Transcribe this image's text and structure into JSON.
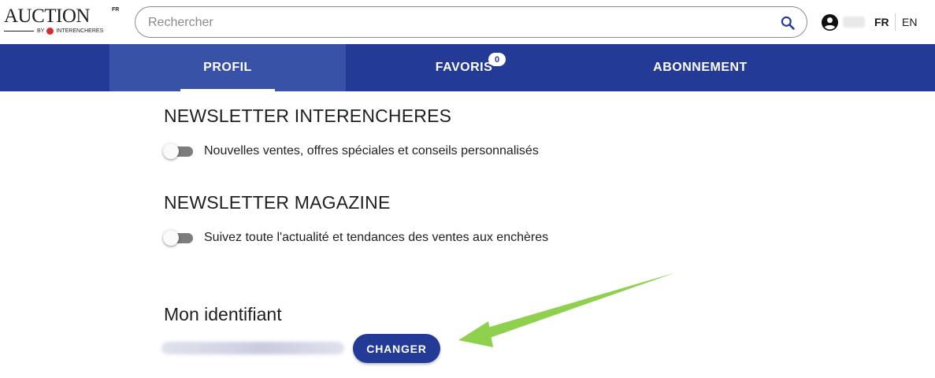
{
  "header": {
    "logo": {
      "main": "AUCTION",
      "superscript": "FR",
      "by": "BY",
      "brand": "INTERENCHERES"
    },
    "search": {
      "placeholder": "Rechercher",
      "value": "",
      "icon": "search-icon"
    },
    "account": {
      "icon": "account-circle-icon"
    },
    "languages": [
      "FR",
      "EN"
    ],
    "active_language": "FR"
  },
  "nav": {
    "tabs": [
      {
        "label": "PROFIL",
        "active": true
      },
      {
        "label": "FAVORIS",
        "badge": "0"
      },
      {
        "label": "ABONNEMENT"
      }
    ]
  },
  "newsletters": [
    {
      "title": "NEWSLETTER INTERENCHERES",
      "option": "Nouvelles ventes, offres spéciales et conseils personnalisés",
      "enabled": false
    },
    {
      "title": "NEWSLETTER MAGAZINE",
      "option": "Suivez toute l'actualité et tendances des ventes aux enchères",
      "enabled": false
    }
  ],
  "identifier": {
    "title": "Mon identifiant",
    "button_label": "CHANGER"
  },
  "colors": {
    "primary": "#233b96",
    "active_tab": "#3752a6",
    "annotation_arrow": "#8fd14f"
  }
}
